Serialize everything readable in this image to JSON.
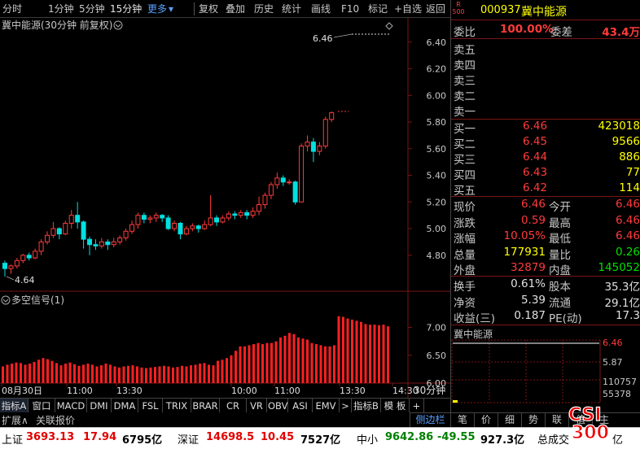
{
  "toolbar": {
    "items": [
      "分时",
      "1分钟",
      "5分钟",
      "15分钟",
      "更多",
      "复权",
      "叠加",
      "历史",
      "统计",
      "画线",
      "F10",
      "标记",
      "+自选",
      "返回"
    ]
  },
  "chart_title": "冀中能源(30分钟 前复权)",
  "price_axis": [
    "6.40",
    "6.20",
    "6.00",
    "5.80",
    "5.60",
    "5.40",
    "5.20",
    "5.00",
    "4.80"
  ],
  "annot_high": "6.46",
  "annot_low": "4.64",
  "sub_title": "多空信号(1)",
  "sub_axis": [
    "7.00",
    "6.50",
    "6.00"
  ],
  "time_axis": [
    "08月30日",
    "11:00",
    "13:30",
    "10:00",
    "11:00",
    "13:30",
    "14:30"
  ],
  "period_label": "30分钟",
  "tabs": [
    "指标A",
    "窗口",
    "MACD",
    "DMI",
    "DMA",
    "FSL",
    "TRIX",
    "BRAR",
    "CR",
    "VR",
    "OBV",
    "ASI",
    "EMV",
    ">",
    "指标B",
    "模 板",
    "+"
  ],
  "left_bottom": {
    "expand": "扩展∧",
    "related": "关联报价"
  },
  "stock": {
    "r_tag": "R",
    "r_num": "500",
    "code": "000937",
    "name": "冀中能源"
  },
  "weibi": {
    "label": "委比",
    "value": "100.00%",
    "label2": "委差",
    "value2": "43.4万"
  },
  "sells": [
    {
      "label": "卖五",
      "price": "",
      "vol": ""
    },
    {
      "label": "卖四",
      "price": "",
      "vol": ""
    },
    {
      "label": "卖三",
      "price": "",
      "vol": ""
    },
    {
      "label": "卖二",
      "price": "",
      "vol": ""
    },
    {
      "label": "卖一",
      "price": "",
      "vol": ""
    }
  ],
  "buys": [
    {
      "label": "买一",
      "price": "6.46",
      "vol": "423018"
    },
    {
      "label": "买二",
      "price": "6.45",
      "vol": "9566"
    },
    {
      "label": "买三",
      "price": "6.44",
      "vol": "886"
    },
    {
      "label": "买四",
      "price": "6.43",
      "vol": "77"
    },
    {
      "label": "买五",
      "price": "6.42",
      "vol": "114"
    }
  ],
  "quote": [
    {
      "l1": "现价",
      "v1": "6.46",
      "l2": "今开",
      "v2": "6.46"
    },
    {
      "l1": "涨跌",
      "v1": "0.59",
      "l2": "最高",
      "v2": "6.46"
    },
    {
      "l1": "涨幅",
      "v1": "10.05%",
      "l2": "最低",
      "v2": "6.46"
    },
    {
      "l1": "总量",
      "v1": "177931",
      "l2": "量比",
      "v2": "0.26"
    },
    {
      "l1": "外盘",
      "v1": "32879",
      "l2": "内盘",
      "v2": "145052"
    }
  ],
  "info": [
    {
      "l1": "换手",
      "v1": "0.61%",
      "l2": "股本",
      "v2": "35.3亿"
    },
    {
      "l1": "净资",
      "v1": "5.39",
      "l2": "流通",
      "v2": "29.1亿"
    },
    {
      "l1": "收益(三)",
      "v1": "0.187",
      "l2": "PE(动)",
      "v2": "17.3"
    }
  ],
  "mini": {
    "title": "冀中能源",
    "p1": "6.46",
    "p2": "5.87",
    "v1": "110757",
    "v2": "55378"
  },
  "right_tabs": [
    "侧边栏",
    "笔",
    "价",
    "细",
    "势",
    "联",
    "值",
    "主"
  ],
  "status": {
    "sh_label": "上证",
    "sh_val": "3693.13",
    "sh_chg": "17.94",
    "sh_amt": "6795亿",
    "sz_label": "深证",
    "sz_val": "14698.5",
    "sz_chg": "10.45",
    "sz_amt": "7527亿",
    "zx_label": "中小",
    "zx_val": "9642.86",
    "zx_chg": "-49.55",
    "zx_amt": "927.3亿",
    "total_label": "总成交",
    "total_unit": "亿"
  },
  "watermark": {
    "line1": "CSI",
    "line2": "300"
  },
  "colors": {
    "up": "#ff3b3b",
    "down": "#00e0e0",
    "bar": "#ff2020",
    "panel_border": "#7a1515"
  },
  "chart_data": {
    "type": "candlestick",
    "candles": [
      [
        4.74,
        4.7,
        4.76,
        4.64
      ],
      [
        4.7,
        4.72,
        4.73,
        4.66
      ],
      [
        4.72,
        4.76,
        4.78,
        4.7
      ],
      [
        4.76,
        4.8,
        4.81,
        4.74
      ],
      [
        4.8,
        4.78,
        4.82,
        4.76
      ],
      [
        4.78,
        4.83,
        4.85,
        4.77
      ],
      [
        4.83,
        4.9,
        4.92,
        4.8
      ],
      [
        4.9,
        4.95,
        4.98,
        4.88
      ],
      [
        4.95,
        5.0,
        5.05,
        4.93
      ],
      [
        5.0,
        4.96,
        5.01,
        4.92
      ],
      [
        4.96,
        5.04,
        5.06,
        4.95
      ],
      [
        5.04,
        5.1,
        5.14,
        5.0
      ],
      [
        5.1,
        5.05,
        5.2,
        5.0
      ],
      [
        5.05,
        4.92,
        5.06,
        4.85
      ],
      [
        4.92,
        4.88,
        4.94,
        4.8
      ],
      [
        4.88,
        4.87,
        4.92,
        4.84
      ],
      [
        4.87,
        4.9,
        4.93,
        4.85
      ],
      [
        4.9,
        4.88,
        4.92,
        4.84
      ],
      [
        4.88,
        4.9,
        4.93,
        4.86
      ],
      [
        4.9,
        4.93,
        4.95,
        4.88
      ],
      [
        4.93,
        4.98,
        5.0,
        4.91
      ],
      [
        4.98,
        5.03,
        5.06,
        4.96
      ],
      [
        5.03,
        5.1,
        5.12,
        5.0
      ],
      [
        5.1,
        5.07,
        5.12,
        5.04
      ],
      [
        5.07,
        5.08,
        5.1,
        5.04
      ],
      [
        5.08,
        5.1,
        5.12,
        5.05
      ],
      [
        5.1,
        5.08,
        5.11,
        5.05
      ],
      [
        5.08,
        5.0,
        5.1,
        4.99
      ],
      [
        5.0,
        5.04,
        5.06,
        4.98
      ],
      [
        5.04,
        4.96,
        5.05,
        4.92
      ],
      [
        4.96,
        5.0,
        5.02,
        4.95
      ],
      [
        5.0,
        5.02,
        5.04,
        4.98
      ],
      [
        5.02,
        5.0,
        5.03,
        4.97
      ],
      [
        5.0,
        5.03,
        5.06,
        4.99
      ],
      [
        5.03,
        5.08,
        5.25,
        5.02
      ],
      [
        5.08,
        5.05,
        5.1,
        5.02
      ],
      [
        5.05,
        5.08,
        5.1,
        5.04
      ],
      [
        5.08,
        5.11,
        5.13,
        5.06
      ],
      [
        5.11,
        5.1,
        5.13,
        5.07
      ],
      [
        5.1,
        5.12,
        5.14,
        5.08
      ],
      [
        5.12,
        5.1,
        5.14,
        5.07
      ],
      [
        5.1,
        5.13,
        5.16,
        5.08
      ],
      [
        5.13,
        5.18,
        5.24,
        5.1
      ],
      [
        5.18,
        5.25,
        5.27,
        5.15
      ],
      [
        5.25,
        5.33,
        5.35,
        5.22
      ],
      [
        5.33,
        5.38,
        5.42,
        5.3
      ],
      [
        5.38,
        5.35,
        5.4,
        5.32
      ],
      [
        5.35,
        5.35,
        5.37,
        5.33
      ],
      [
        5.35,
        5.2,
        5.36,
        5.18
      ],
      [
        5.2,
        5.62,
        5.64,
        5.2
      ],
      [
        5.62,
        5.65,
        5.7,
        5.58
      ],
      [
        5.65,
        5.58,
        5.68,
        5.5
      ],
      [
        5.58,
        5.62,
        5.65,
        5.55
      ],
      [
        5.62,
        5.82,
        5.84,
        5.6
      ],
      [
        5.82,
        5.87,
        5.88,
        5.8
      ]
    ],
    "signal": [
      6.3,
      6.33,
      6.35,
      6.37,
      6.36,
      6.33,
      6.35,
      6.38,
      6.42,
      6.45,
      6.43,
      6.4,
      6.36,
      6.32,
      6.35,
      6.37,
      6.34,
      6.31,
      6.33,
      6.35,
      6.33,
      6.3,
      6.32,
      6.35,
      6.33,
      6.3,
      6.28,
      6.3,
      6.31,
      6.32,
      6.3,
      6.28,
      6.27,
      6.28,
      6.29,
      6.3,
      6.31,
      6.3,
      6.28,
      6.29,
      6.31,
      6.3,
      6.32,
      6.33,
      6.35,
      6.36,
      6.33,
      6.32,
      6.4,
      6.42,
      6.45,
      6.5,
      6.58,
      6.66,
      6.66,
      6.68,
      6.7,
      6.72,
      6.7,
      6.72,
      6.72,
      6.75,
      6.82,
      6.85,
      6.9,
      6.88,
      6.82,
      6.8,
      6.78,
      6.72,
      6.7,
      6.68,
      6.66,
      6.66,
      6.68,
      7.2,
      7.19,
      7.16,
      7.14,
      7.12,
      7.1,
      7.06,
      7.05,
      7.05,
      7.04,
      7.05,
      7.02
    ]
  }
}
